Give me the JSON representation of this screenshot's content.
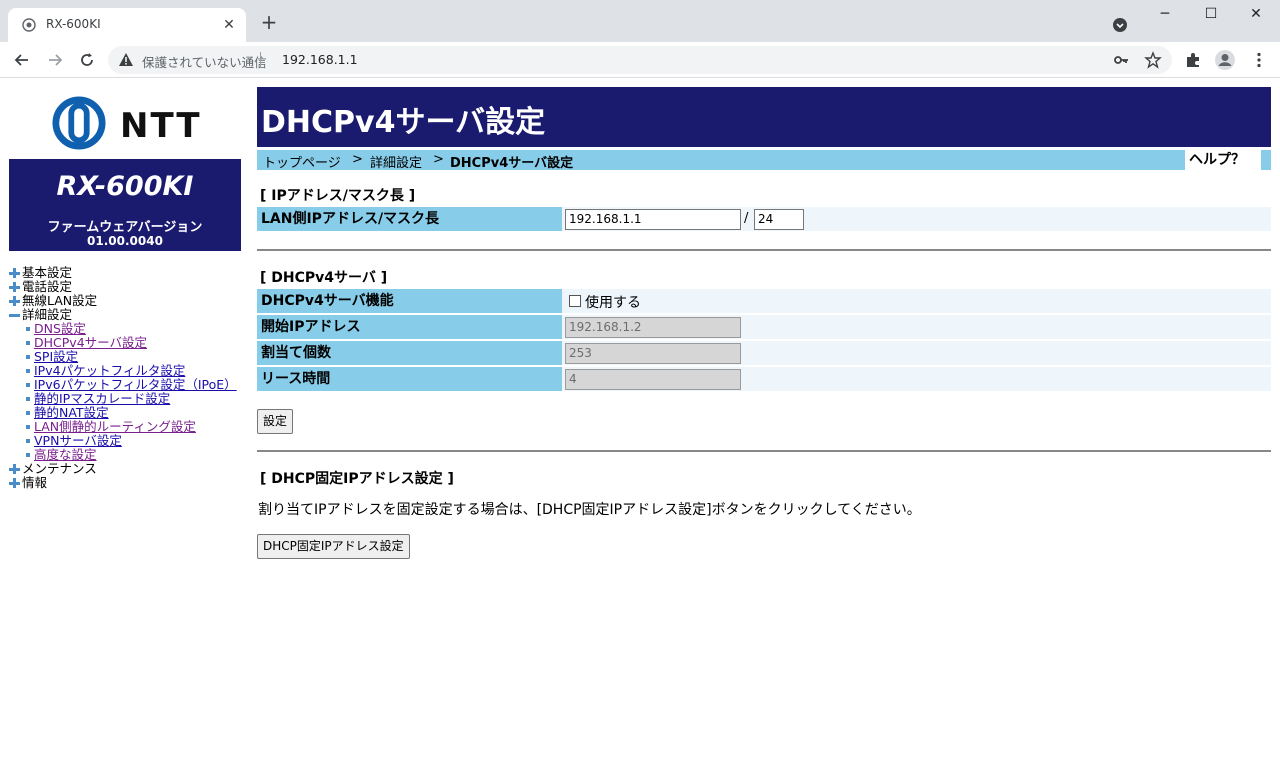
{
  "browser": {
    "tab_title": "RX-600KI",
    "security_text": "保護されていない通信",
    "url": "192.168.1.1"
  },
  "sidebar": {
    "logo_text": "NTT",
    "model": "RX-600KI",
    "firmware_label": "ファームウェアバージョン",
    "firmware_version": "01.00.0040",
    "menu": {
      "basic": "基本設定",
      "phone": "電話設定",
      "wlan": "無線LAN設定",
      "advanced": "詳細設定",
      "advanced_items": [
        "DNS設定",
        "DHCPv4サーバ設定",
        "SPI設定",
        "IPv4パケットフィルタ設定",
        "IPv6パケットフィルタ設定（IPoE）",
        "静的IPマスカレード設定",
        "静的NAT設定",
        "LAN側静的ルーティング設定",
        "VPNサーバ設定",
        "高度な設定"
      ],
      "maintenance": "メンテナンス",
      "info": "情報"
    }
  },
  "main": {
    "title": "DHCPv4サーバ設定",
    "breadcrumb": {
      "top": "トップページ",
      "sep": ">",
      "detail": "詳細設定",
      "current": "DHCPv4サーバ設定"
    },
    "help": "ヘルプ？",
    "ip_section": {
      "title": "[ IPアドレス/マスク長 ]",
      "label": "LAN側IPアドレス/マスク長",
      "ip_value": "192.168.1.1",
      "slash": "/",
      "mask_value": "24"
    },
    "dhcp_section": {
      "title": "[ DHCPv4サーバ ]",
      "function_label": "DHCPv4サーバ機能",
      "use_label": "使用する",
      "use_checked": false,
      "start_label": "開始IPアドレス",
      "start_value": "192.168.1.2",
      "count_label": "割当て個数",
      "count_value": "253",
      "lease_label": "リース時間",
      "lease_value": "4",
      "submit": "設定"
    },
    "fixed_section": {
      "title": "[ DHCP固定IPアドレス設定 ]",
      "description": "割り当てIPアドレスを固定設定する場合は、[DHCP固定IPアドレス設定]ボタンをクリックしてください。",
      "button": "DHCP固定IPアドレス設定"
    }
  }
}
